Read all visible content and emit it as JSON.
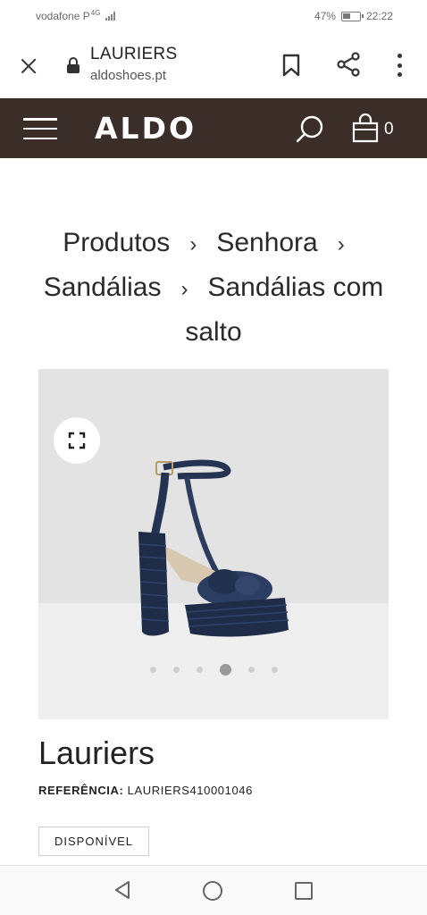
{
  "status_bar": {
    "carrier": "vodafone P",
    "network": "4G",
    "battery": "47%",
    "time": "22:22"
  },
  "browser": {
    "page_title": "LAURIERS",
    "domain": "aldoshoes.pt",
    "icons": [
      "close-icon",
      "lock-icon",
      "bookmark-icon",
      "share-icon",
      "more-vert-icon"
    ]
  },
  "header": {
    "logo": "ALDO",
    "cart_count": "0",
    "brand_color": "#3b2d28",
    "icons": [
      "menu-icon",
      "search-icon",
      "bag-icon"
    ]
  },
  "breadcrumb": {
    "items": [
      "Produtos",
      "Senhora",
      "Sandálias",
      "Sandálias com salto"
    ],
    "separator": "›"
  },
  "gallery": {
    "image_count": 6,
    "active_index": 3,
    "expand_icon": "expand-icon"
  },
  "product": {
    "name": "Lauriers",
    "ref_label": "REFERÊNCIA:",
    "ref_value": "LAURIERS410001046",
    "availability": "DISPONÍVEL"
  },
  "system_nav": {
    "icons": [
      "back-icon",
      "home-icon",
      "recents-icon"
    ]
  }
}
